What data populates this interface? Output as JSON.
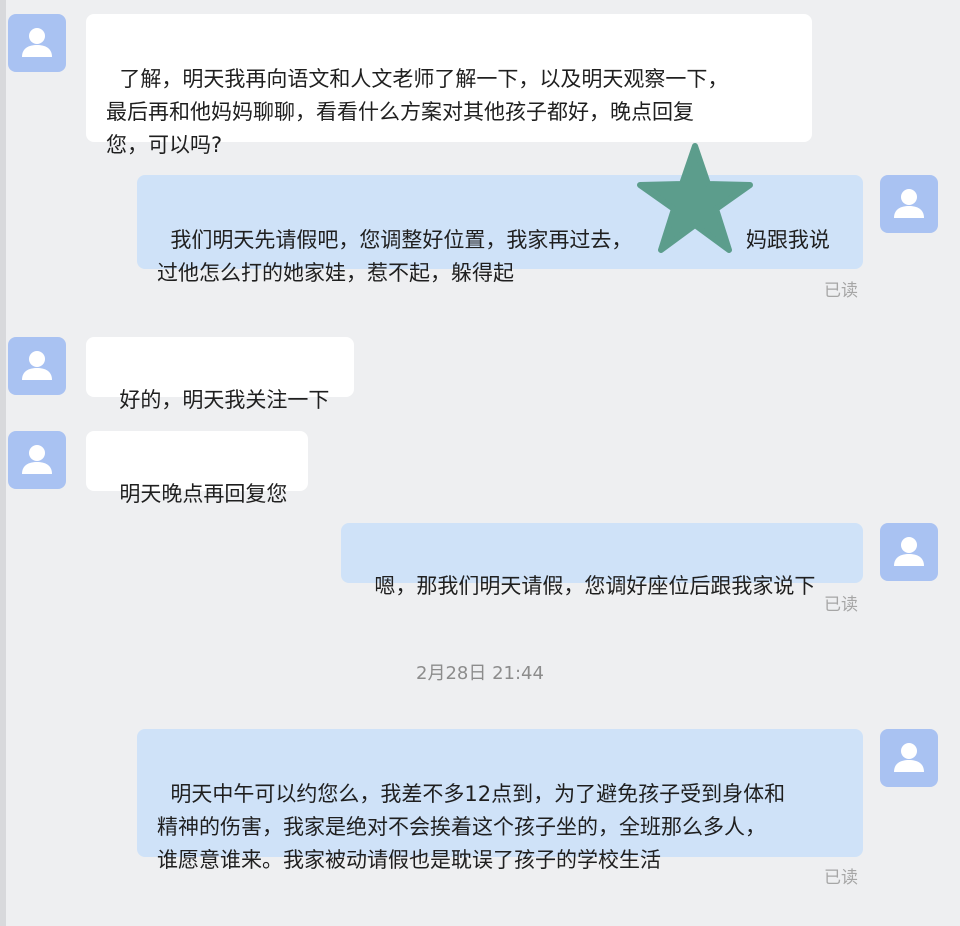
{
  "chat": {
    "messages": [
      {
        "side": "in",
        "text": "了解，明天我再向语文和人文老师了解一下，以及明天观察一下，\n最后再和他妈妈聊聊，看看什么方案对其他孩子都好，晚点回复\n您，可以吗?"
      },
      {
        "side": "out",
        "text": "我们明天先请假吧，您调整好位置，我家再过去，                 妈跟我说\n过他怎么打的她家娃，惹不起，躲得起",
        "status": "已读"
      },
      {
        "side": "in",
        "text": "好的，明天我关注一下"
      },
      {
        "side": "in",
        "text": "明天晚点再回复您"
      },
      {
        "side": "out",
        "text": "嗯，那我们明天请假，您调好座位后跟我家说下",
        "status": "已读"
      },
      {
        "side": "out",
        "text": "明天中午可以约您么，我差不多12点到，为了避免孩子受到身体和\n精神的伤害，我家是绝对不会挨着这个孩子坐的，全班那么多人，\n谁愿意谁来。我家被动请假也是耽误了孩子的学校生活",
        "status": "已读"
      }
    ],
    "timestamp": "2月28日 21:44"
  },
  "icons": {
    "avatar": "user-silhouette-icon",
    "overlay": "star-icon"
  },
  "colors": {
    "background": "#eeeff1",
    "incoming_bubble": "#ffffff",
    "outgoing_bubble": "#cfe2f8",
    "avatar": "#a9c2f2",
    "star": "#5c9d8c",
    "read_status": "#a6a6a6"
  }
}
